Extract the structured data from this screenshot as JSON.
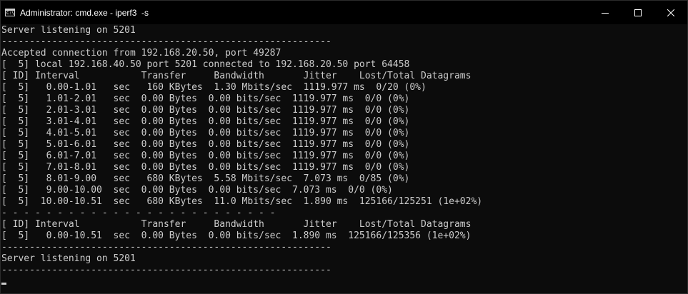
{
  "window": {
    "icon_label": "C:\\",
    "title": "Administrator: cmd.exe - iperf3  -s"
  },
  "terminal_lines": [
    "Server listening on 5201",
    "-----------------------------------------------------------",
    "Accepted connection from 192.168.20.50, port 49287",
    "[  5] local 192.168.40.50 port 5201 connected to 192.168.20.50 port 64458",
    "[ ID] Interval           Transfer     Bandwidth       Jitter    Lost/Total Datagrams",
    "[  5]   0.00-1.01   sec   160 KBytes  1.30 Mbits/sec  1119.977 ms  0/20 (0%)",
    "[  5]   1.01-2.01   sec  0.00 Bytes  0.00 bits/sec  1119.977 ms  0/0 (0%)",
    "[  5]   2.01-3.01   sec  0.00 Bytes  0.00 bits/sec  1119.977 ms  0/0 (0%)",
    "[  5]   3.01-4.01   sec  0.00 Bytes  0.00 bits/sec  1119.977 ms  0/0 (0%)",
    "[  5]   4.01-5.01   sec  0.00 Bytes  0.00 bits/sec  1119.977 ms  0/0 (0%)",
    "[  5]   5.01-6.01   sec  0.00 Bytes  0.00 bits/sec  1119.977 ms  0/0 (0%)",
    "[  5]   6.01-7.01   sec  0.00 Bytes  0.00 bits/sec  1119.977 ms  0/0 (0%)",
    "[  5]   7.01-8.01   sec  0.00 Bytes  0.00 bits/sec  1119.977 ms  0/0 (0%)",
    "[  5]   8.01-9.00   sec   680 KBytes  5.58 Mbits/sec  7.073 ms  0/85 (0%)",
    "[  5]   9.00-10.00  sec  0.00 Bytes  0.00 bits/sec  7.073 ms  0/0 (0%)",
    "[  5]  10.00-10.51  sec   680 KBytes  11.0 Mbits/sec  1.890 ms  125166/125251 (1e+02%)",
    "- - - - - - - - - - - - - - - - - - - - - - - - -",
    "[ ID] Interval           Transfer     Bandwidth       Jitter    Lost/Total Datagrams",
    "[  5]   0.00-10.51  sec  0.00 Bytes  0.00 bits/sec  1.890 ms  125166/125356 (1e+02%)",
    "-----------------------------------------------------------",
    "Server listening on 5201",
    "-----------------------------------------------------------"
  ]
}
